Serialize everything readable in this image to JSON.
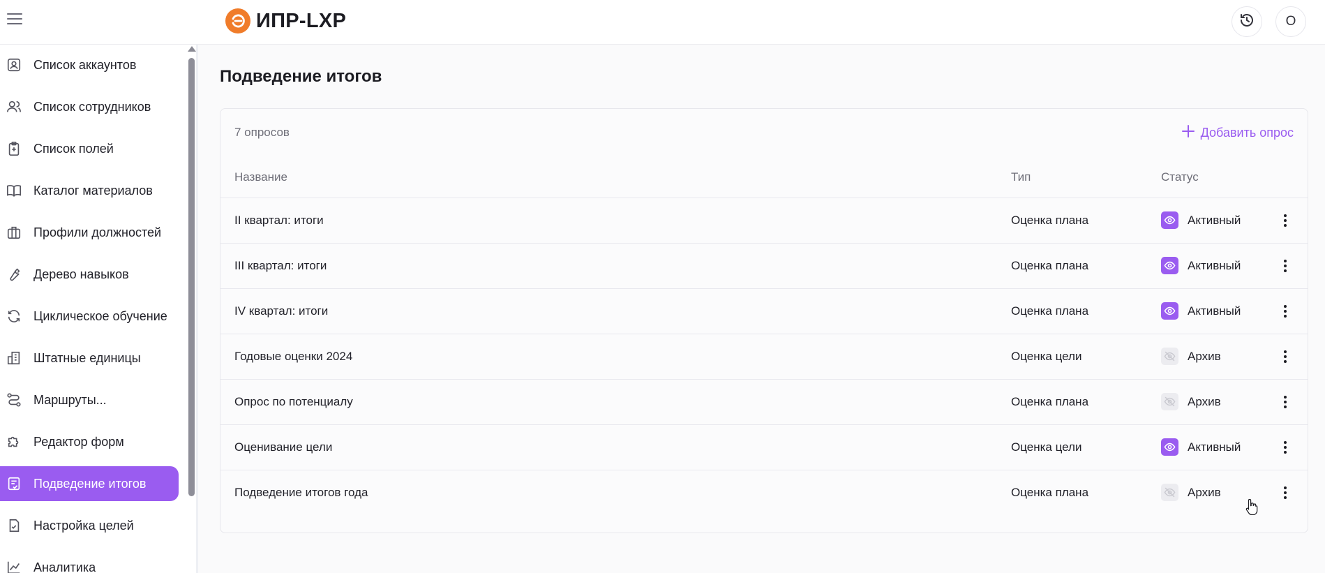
{
  "header": {
    "logo_text": "ИПР-LXP",
    "avatar_initial": "O"
  },
  "sidebar": {
    "items": [
      {
        "label": "Список аккаунтов",
        "icon": "account-card-icon",
        "active": false
      },
      {
        "label": "Список сотрудников",
        "icon": "users-icon",
        "active": false
      },
      {
        "label": "Список полей",
        "icon": "clipboard-plus-icon",
        "active": false
      },
      {
        "label": "Каталог материалов",
        "icon": "book-icon",
        "active": false
      },
      {
        "label": "Профили должностей",
        "icon": "briefcase-icon",
        "active": false
      },
      {
        "label": "Дерево навыков",
        "icon": "wrench-icon",
        "active": false
      },
      {
        "label": "Циклическое обучение",
        "icon": "refresh-icon",
        "active": false
      },
      {
        "label": "Штатные единицы",
        "icon": "building-icon",
        "active": false
      },
      {
        "label": "Маршруты...",
        "icon": "route-icon",
        "active": false
      },
      {
        "label": "Редактор форм",
        "icon": "puzzle-icon",
        "active": false
      },
      {
        "label": "Подведение итогов",
        "icon": "report-check-icon",
        "active": true
      },
      {
        "label": "Настройка целей",
        "icon": "file-check-icon",
        "active": false
      },
      {
        "label": "Аналитика",
        "icon": "chart-line-icon",
        "active": false
      }
    ]
  },
  "main": {
    "title": "Подведение итогов",
    "count_label": "7 опросов",
    "add_label": "Добавить опрос",
    "columns": {
      "name": "Название",
      "type": "Тип",
      "status": "Статус"
    },
    "rows": [
      {
        "name": "II квартал: итоги",
        "type": "Оценка плана",
        "status": "Активный",
        "active": true
      },
      {
        "name": "III квартал: итоги",
        "type": "Оценка плана",
        "status": "Активный",
        "active": true
      },
      {
        "name": "IV квартал: итоги",
        "type": "Оценка плана",
        "status": "Активный",
        "active": true
      },
      {
        "name": "Годовые оценки 2024",
        "type": "Оценка цели",
        "status": "Архив",
        "active": false
      },
      {
        "name": "Опрос по потенциалу",
        "type": "Оценка плана",
        "status": "Архив",
        "active": false
      },
      {
        "name": "Оценивание цели",
        "type": "Оценка цели",
        "status": "Активный",
        "active": true
      },
      {
        "name": "Подведение итогов года",
        "type": "Оценка плана",
        "status": "Архив",
        "active": false
      }
    ]
  },
  "colors": {
    "accent": "#9a5cf0",
    "logo_orange": "#f07c2a"
  }
}
